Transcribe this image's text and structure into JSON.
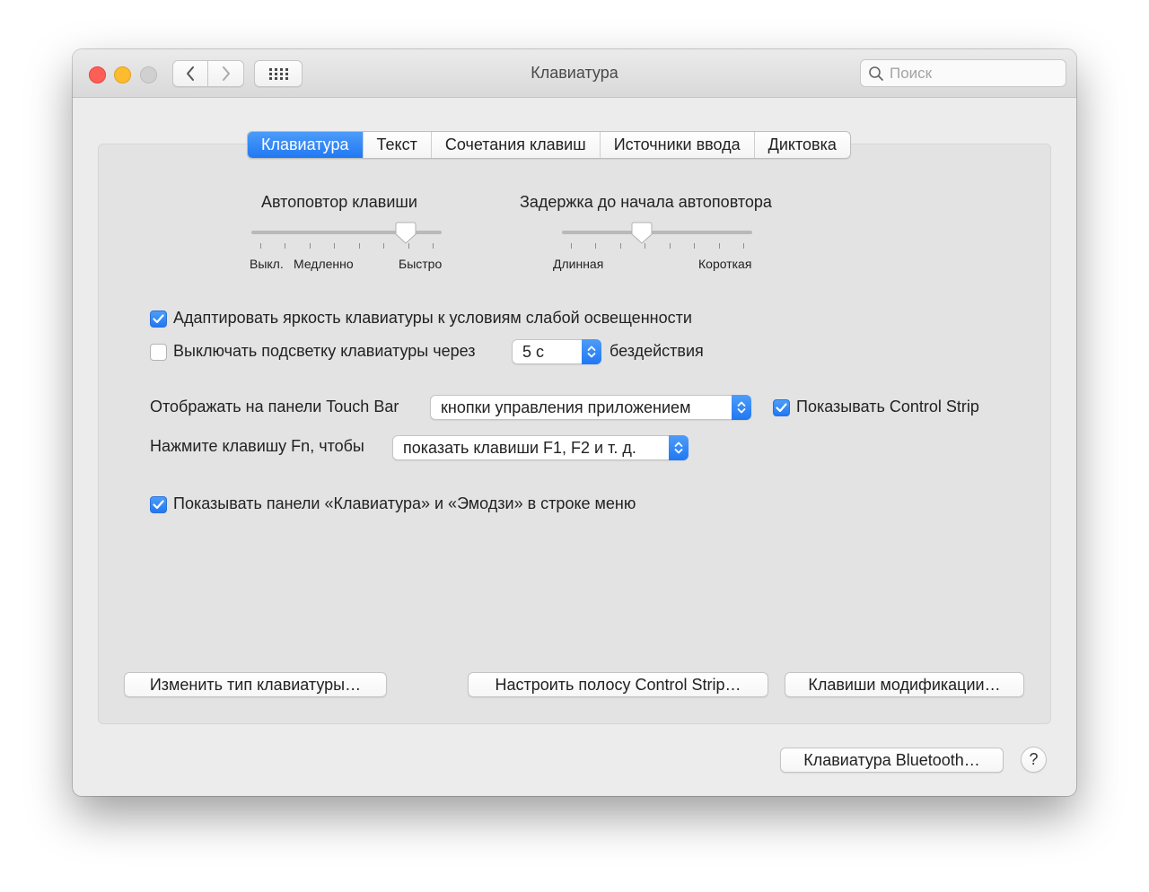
{
  "window": {
    "title": "Клавиатура",
    "search_placeholder": "Поиск"
  },
  "tabs": [
    {
      "label": "Клавиатура",
      "active": true
    },
    {
      "label": "Текст",
      "active": false
    },
    {
      "label": "Сочетания клавиш",
      "active": false
    },
    {
      "label": "Источники ввода",
      "active": false
    },
    {
      "label": "Диктовка",
      "active": false
    }
  ],
  "key_repeat": {
    "title": "Автоповтор клавиши",
    "labels": [
      "Выкл.",
      "Медленно",
      "Быстро"
    ],
    "value_fraction": 0.81
  },
  "delay_until_repeat": {
    "title": "Задержка до начала автоповтора",
    "labels": [
      "Длинная",
      "Короткая"
    ],
    "value_fraction": 0.42
  },
  "options": {
    "adjust_brightness": {
      "label": "Адаптировать яркость клавиатуры к условиям слабой освещенности",
      "checked": true
    },
    "backlight_off": {
      "label": "Выключать подсветку клавиатуры через",
      "checked": false,
      "value": "5 с",
      "suffix": "бездействия"
    },
    "touch_bar": {
      "label": "Отображать на панели Touch Bar",
      "value": "кнопки управления приложением"
    },
    "control_strip": {
      "label": "Показывать Control Strip",
      "checked": true
    },
    "fn_key": {
      "label": "Нажмите клавишу Fn, чтобы",
      "value": "показать клавиши F1, F2 и т. д."
    },
    "show_panels": {
      "label": "Показывать панели «Клавиатура» и «Эмодзи» в строке меню",
      "checked": true
    }
  },
  "buttons": {
    "change_keyboard_type": "Изменить тип клавиатуры…",
    "customize_control_strip": "Настроить полосу Control Strip…",
    "modifier_keys": "Клавиши модификации…",
    "bluetooth_keyboard": "Клавиатура Bluetooth…",
    "help": "?"
  },
  "colors": {
    "accent": "#2a7cf5",
    "window_bg": "#ececec",
    "panel_bg": "#e3e3e3"
  }
}
